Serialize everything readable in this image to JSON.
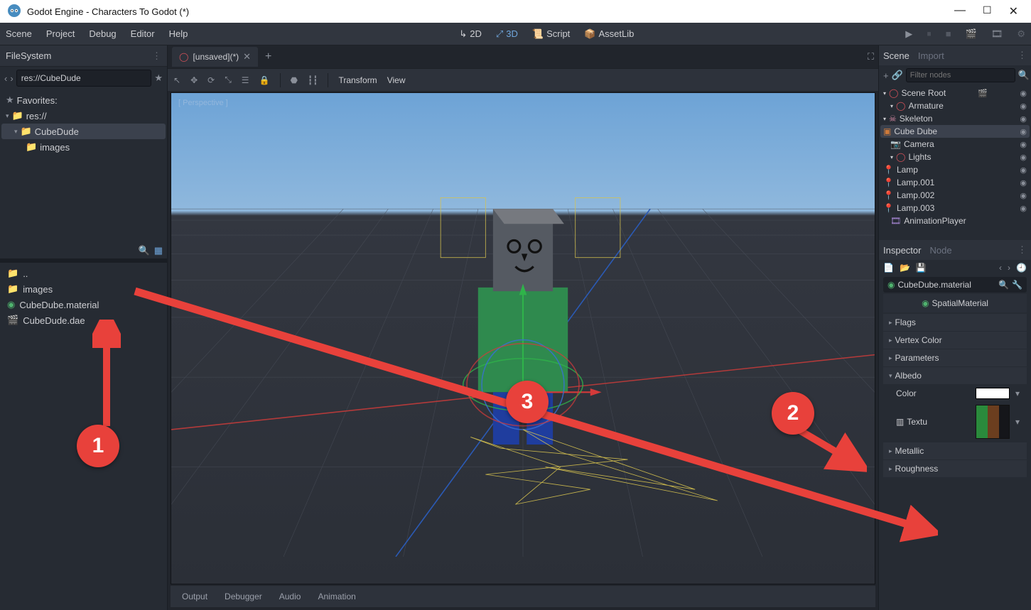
{
  "window": {
    "title": "Godot Engine - Characters To Godot (*)"
  },
  "menu": {
    "scene": "Scene",
    "project": "Project",
    "debug": "Debug",
    "editor": "Editor",
    "help": "Help",
    "ws2d": "2D",
    "ws3d": "3D",
    "script": "Script",
    "assetlib": "AssetLib"
  },
  "filesystem": {
    "title": "FileSystem",
    "path": "res://CubeDude",
    "favorites": "Favorites:",
    "root": "res://",
    "folder_cubedude": "CubeDude",
    "folder_images": "images",
    "up": "..",
    "list": {
      "images": "images",
      "material": "CubeDube.material",
      "dae": "CubeDude.dae"
    }
  },
  "tabs": {
    "unsaved": "[unsaved](*)"
  },
  "toolbar3d": {
    "transform": "Transform",
    "view": "View",
    "perspective": "[ Perspective ]"
  },
  "bottom": {
    "output": "Output",
    "debugger": "Debugger",
    "audio": "Audio",
    "animation": "Animation"
  },
  "scene_panel": {
    "tab_scene": "Scene",
    "tab_import": "Import",
    "filter_placeholder": "Filter nodes",
    "root": "Scene Root",
    "armature": "Armature",
    "skeleton": "Skeleton",
    "cube_dube": "Cube Dube",
    "camera": "Camera",
    "lights": "Lights",
    "lamp": "Lamp",
    "lamp001": "Lamp.001",
    "lamp002": "Lamp.002",
    "lamp003": "Lamp.003",
    "anim": "AnimationPlayer"
  },
  "inspector": {
    "tab_inspector": "Inspector",
    "tab_node": "Node",
    "resource": "CubeDube.material",
    "type": "SpatialMaterial",
    "flags": "Flags",
    "vertex": "Vertex Color",
    "params": "Parameters",
    "albedo": "Albedo",
    "color": "Color",
    "texture": "Textu",
    "metallic": "Metallic",
    "roughness": "Roughness"
  },
  "callouts": {
    "c1": "1",
    "c2": "2",
    "c3": "3"
  }
}
